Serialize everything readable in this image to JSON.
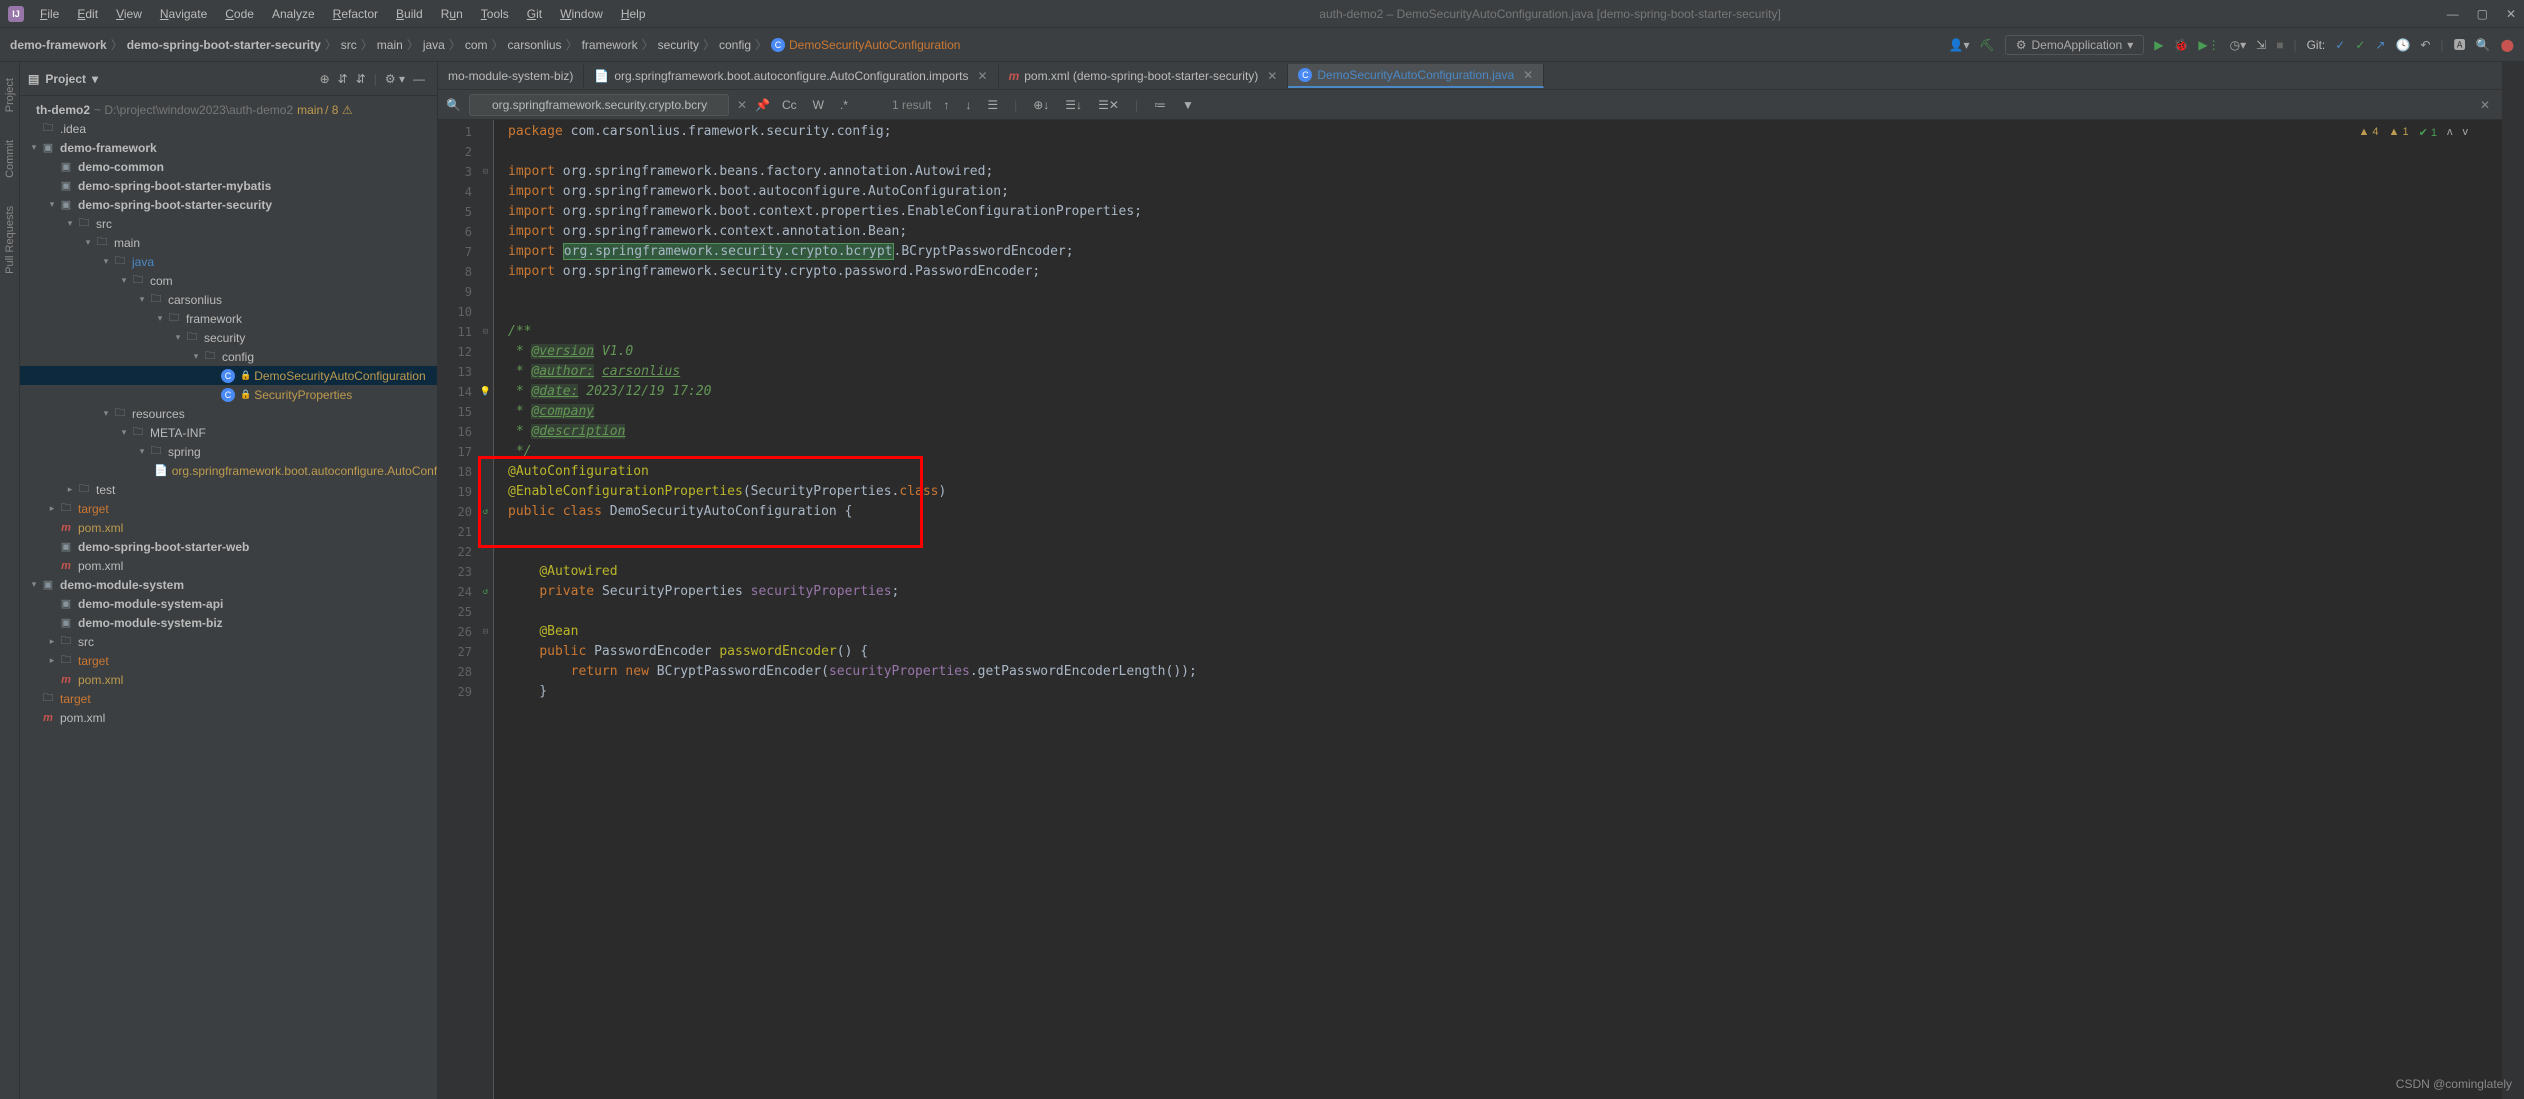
{
  "title": "auth-demo2 – DemoSecurityAutoConfiguration.java [demo-spring-boot-starter-security]",
  "menu": {
    "file": "File",
    "edit": "Edit",
    "view": "View",
    "navigate": "Navigate",
    "code": "Code",
    "analyze": "Analyze",
    "refactor": "Refactor",
    "build": "Build",
    "run": "Run",
    "tools": "Tools",
    "git": "Git",
    "window": "Window",
    "help": "Help"
  },
  "breadcrumb": [
    "demo-framework",
    "demo-spring-boot-starter-security",
    "src",
    "main",
    "java",
    "com",
    "carsonlius",
    "framework",
    "security",
    "config",
    "DemoSecurityAutoConfiguration"
  ],
  "runconfig": "DemoApplication",
  "git_label": "Git:",
  "projectpane": {
    "title": "Project"
  },
  "proj_root": {
    "name": "th-demo2",
    "path": "~  D:\\project\\window2023\\auth-demo2",
    "branch": "main",
    "status": "/ 8 ⚠"
  },
  "tree": [
    {
      "depth": 0,
      "icon": "folder",
      "label": ".idea",
      "bold": false
    },
    {
      "depth": 0,
      "icon": "module",
      "label": "demo-framework",
      "bold": true,
      "arrow": "down"
    },
    {
      "depth": 1,
      "icon": "module",
      "label": "demo-common",
      "bold": true
    },
    {
      "depth": 1,
      "icon": "module",
      "label": "demo-spring-boot-starter-mybatis",
      "bold": true
    },
    {
      "depth": 1,
      "icon": "module",
      "label": "demo-spring-boot-starter-security",
      "bold": true,
      "arrow": "down"
    },
    {
      "depth": 2,
      "icon": "folder",
      "label": "src",
      "arrow": "down"
    },
    {
      "depth": 3,
      "icon": "folder",
      "label": "main",
      "arrow": "down"
    },
    {
      "depth": 4,
      "icon": "folder",
      "label": "java",
      "arrow": "down",
      "color": "blue"
    },
    {
      "depth": 5,
      "icon": "folder",
      "label": "com",
      "arrow": "down"
    },
    {
      "depth": 6,
      "icon": "folder",
      "label": "carsonlius",
      "arrow": "down"
    },
    {
      "depth": 7,
      "icon": "folder",
      "label": "framework",
      "arrow": "down"
    },
    {
      "depth": 8,
      "icon": "folder",
      "label": "security",
      "arrow": "down"
    },
    {
      "depth": 9,
      "icon": "folder",
      "label": "config",
      "arrow": "down"
    },
    {
      "depth": 10,
      "icon": "class",
      "label": "DemoSecurityAutoConfiguration",
      "color": "yellow",
      "selected": true,
      "lock": true
    },
    {
      "depth": 10,
      "icon": "class",
      "label": "SecurityProperties",
      "color": "yellow",
      "lock": true
    },
    {
      "depth": 4,
      "icon": "folder",
      "label": "resources",
      "arrow": "down"
    },
    {
      "depth": 5,
      "icon": "folder",
      "label": "META-INF",
      "arrow": "down"
    },
    {
      "depth": 6,
      "icon": "folder",
      "label": "spring",
      "arrow": "down"
    },
    {
      "depth": 7,
      "icon": "file",
      "label": "org.springframework.boot.autoconfigure.AutoConfigura",
      "color": "yellow"
    },
    {
      "depth": 2,
      "icon": "folder",
      "label": "test",
      "arrow": "right"
    },
    {
      "depth": 1,
      "icon": "folder",
      "label": "target",
      "arrow": "right",
      "color": "orange"
    },
    {
      "depth": 1,
      "icon": "m",
      "label": "pom.xml",
      "color": "yellow"
    },
    {
      "depth": 1,
      "icon": "module",
      "label": "demo-spring-boot-starter-web",
      "bold": true
    },
    {
      "depth": 1,
      "icon": "m",
      "label": "pom.xml"
    },
    {
      "depth": 0,
      "icon": "module",
      "label": "demo-module-system",
      "bold": true,
      "arrow": "down"
    },
    {
      "depth": 1,
      "icon": "module",
      "label": "demo-module-system-api",
      "bold": true
    },
    {
      "depth": 1,
      "icon": "module",
      "label": "demo-module-system-biz",
      "bold": true
    },
    {
      "depth": 1,
      "icon": "folder",
      "label": "src",
      "arrow": "right"
    },
    {
      "depth": 1,
      "icon": "folder",
      "label": "target",
      "arrow": "right",
      "color": "orange"
    },
    {
      "depth": 1,
      "icon": "m",
      "label": "pom.xml",
      "color": "yellow"
    },
    {
      "depth": 0,
      "icon": "folder",
      "label": "target",
      "color": "orange"
    },
    {
      "depth": 0,
      "icon": "m",
      "label": "pom.xml"
    }
  ],
  "tabs": [
    {
      "label": "mo-module-system-biz)",
      "active": false,
      "trunc": true
    },
    {
      "label": "org.springframework.boot.autoconfigure.AutoConfiguration.imports",
      "active": false,
      "closeable": true,
      "icon": "file"
    },
    {
      "label": "pom.xml (demo-spring-boot-starter-security)",
      "active": false,
      "closeable": true,
      "icon": "m"
    },
    {
      "label": "DemoSecurityAutoConfiguration.java",
      "active": true,
      "closeable": true,
      "icon": "class",
      "color": "#4a88c7"
    }
  ],
  "find": {
    "query": "org.springframework.security.crypto.bcrypt",
    "results": "1 result",
    "cc": "Cc",
    "word": "W",
    "regex": ".*"
  },
  "inspect": {
    "warn1": "4",
    "warn2": "1",
    "ok": "1"
  },
  "code": [
    {
      "n": 1,
      "html": "<span class='kw'>package</span> <span class='typ'>com.carsonlius.framework.security.config</span>;"
    },
    {
      "n": 2,
      "html": ""
    },
    {
      "n": 3,
      "html": "<span class='kw'>import</span> <span class='typ'>org.springframework.beans.factory.annotation.</span><span class='typ'>Autowired</span>;",
      "fold": "-"
    },
    {
      "n": 4,
      "html": "<span class='kw'>import</span> <span class='typ'>org.springframework.boot.autoconfigure.</span><span class='typ'>AutoConfiguration</span>;"
    },
    {
      "n": 5,
      "html": "<span class='kw'>import</span> <span class='typ'>org.springframework.boot.context.properties.</span><span class='typ'>EnableConfigurationProperties</span>;"
    },
    {
      "n": 6,
      "html": "<span class='kw'>import</span> <span class='typ'>org.springframework.context.annotation.</span><span class='typ'>Bean</span>;"
    },
    {
      "n": 7,
      "html": "<span class='kw'>import</span> <span class='highlight'>org.springframework.security.crypto.bcrypt</span>.<span class='typ'>BCryptPasswordEncoder</span>;"
    },
    {
      "n": 8,
      "html": "<span class='kw'>import</span> <span class='typ'>org.springframework.security.crypto.password.</span><span class='typ'>PasswordEncoder</span>;"
    },
    {
      "n": 9,
      "html": ""
    },
    {
      "n": 10,
      "html": ""
    },
    {
      "n": 11,
      "html": "<span class='doc'>/**</span>",
      "fold": "-"
    },
    {
      "n": 12,
      "html": "<span class='doc'> * <span class='doctag'>@version</span> V1.0</span>"
    },
    {
      "n": 13,
      "html": "<span class='doc'> * <span class='doctag'>@author:</span> <u>carsonlius</u></span>"
    },
    {
      "n": 14,
      "html": "<span class='doc'> * <span class='doctag'>@date:</span> 2023/12/19 17:20</span>",
      "bulb": true
    },
    {
      "n": 15,
      "html": "<span class='doc'> * <span class='doctag'>@company</span></span>"
    },
    {
      "n": 16,
      "html": "<span class='doc'> * <span class='doctag'>@description</span></span>"
    },
    {
      "n": 17,
      "html": "<span class='doc'> */</span>"
    },
    {
      "n": 18,
      "html": "<span class='ann'>@AutoConfiguration</span>"
    },
    {
      "n": 19,
      "html": "<span class='ann'>@EnableConfigurationProperties</span>(<span class='typ'>SecurityProperties</span>.<span class='kw'>class</span>)"
    },
    {
      "n": 20,
      "html": "<span class='kw'>public</span> <span class='kw'>class</span> <span class='cls'>DemoSecurityAutoConfiguration</span> {",
      "fold": "-",
      "run": true
    },
    {
      "n": 21,
      "html": ""
    },
    {
      "n": 22,
      "html": ""
    },
    {
      "n": 23,
      "html": "    <span class='ann'>@Autowired</span>"
    },
    {
      "n": 24,
      "html": "    <span class='kw'>private</span> <span class='typ'>SecurityProperties</span> <span class='fld'>securityProperties</span>;",
      "run": true
    },
    {
      "n": 25,
      "html": ""
    },
    {
      "n": 26,
      "html": "    <span class='ann'>@Bean</span>",
      "fold": "-"
    },
    {
      "n": 27,
      "html": "    <span class='kw'>public</span> <span class='typ'>PasswordEncoder</span> <span class='ann'>passwordEncoder</span>() {"
    },
    {
      "n": 28,
      "html": "        <span class='kw'>return</span> <span class='kw'>new</span> <span class='typ'>BCryptPasswordEncoder</span>(<span class='fld'>securityProperties</span>.getPasswordEncoderLength());"
    },
    {
      "n": 29,
      "html": "    }"
    }
  ],
  "watermark": "CSDN @cominglately"
}
